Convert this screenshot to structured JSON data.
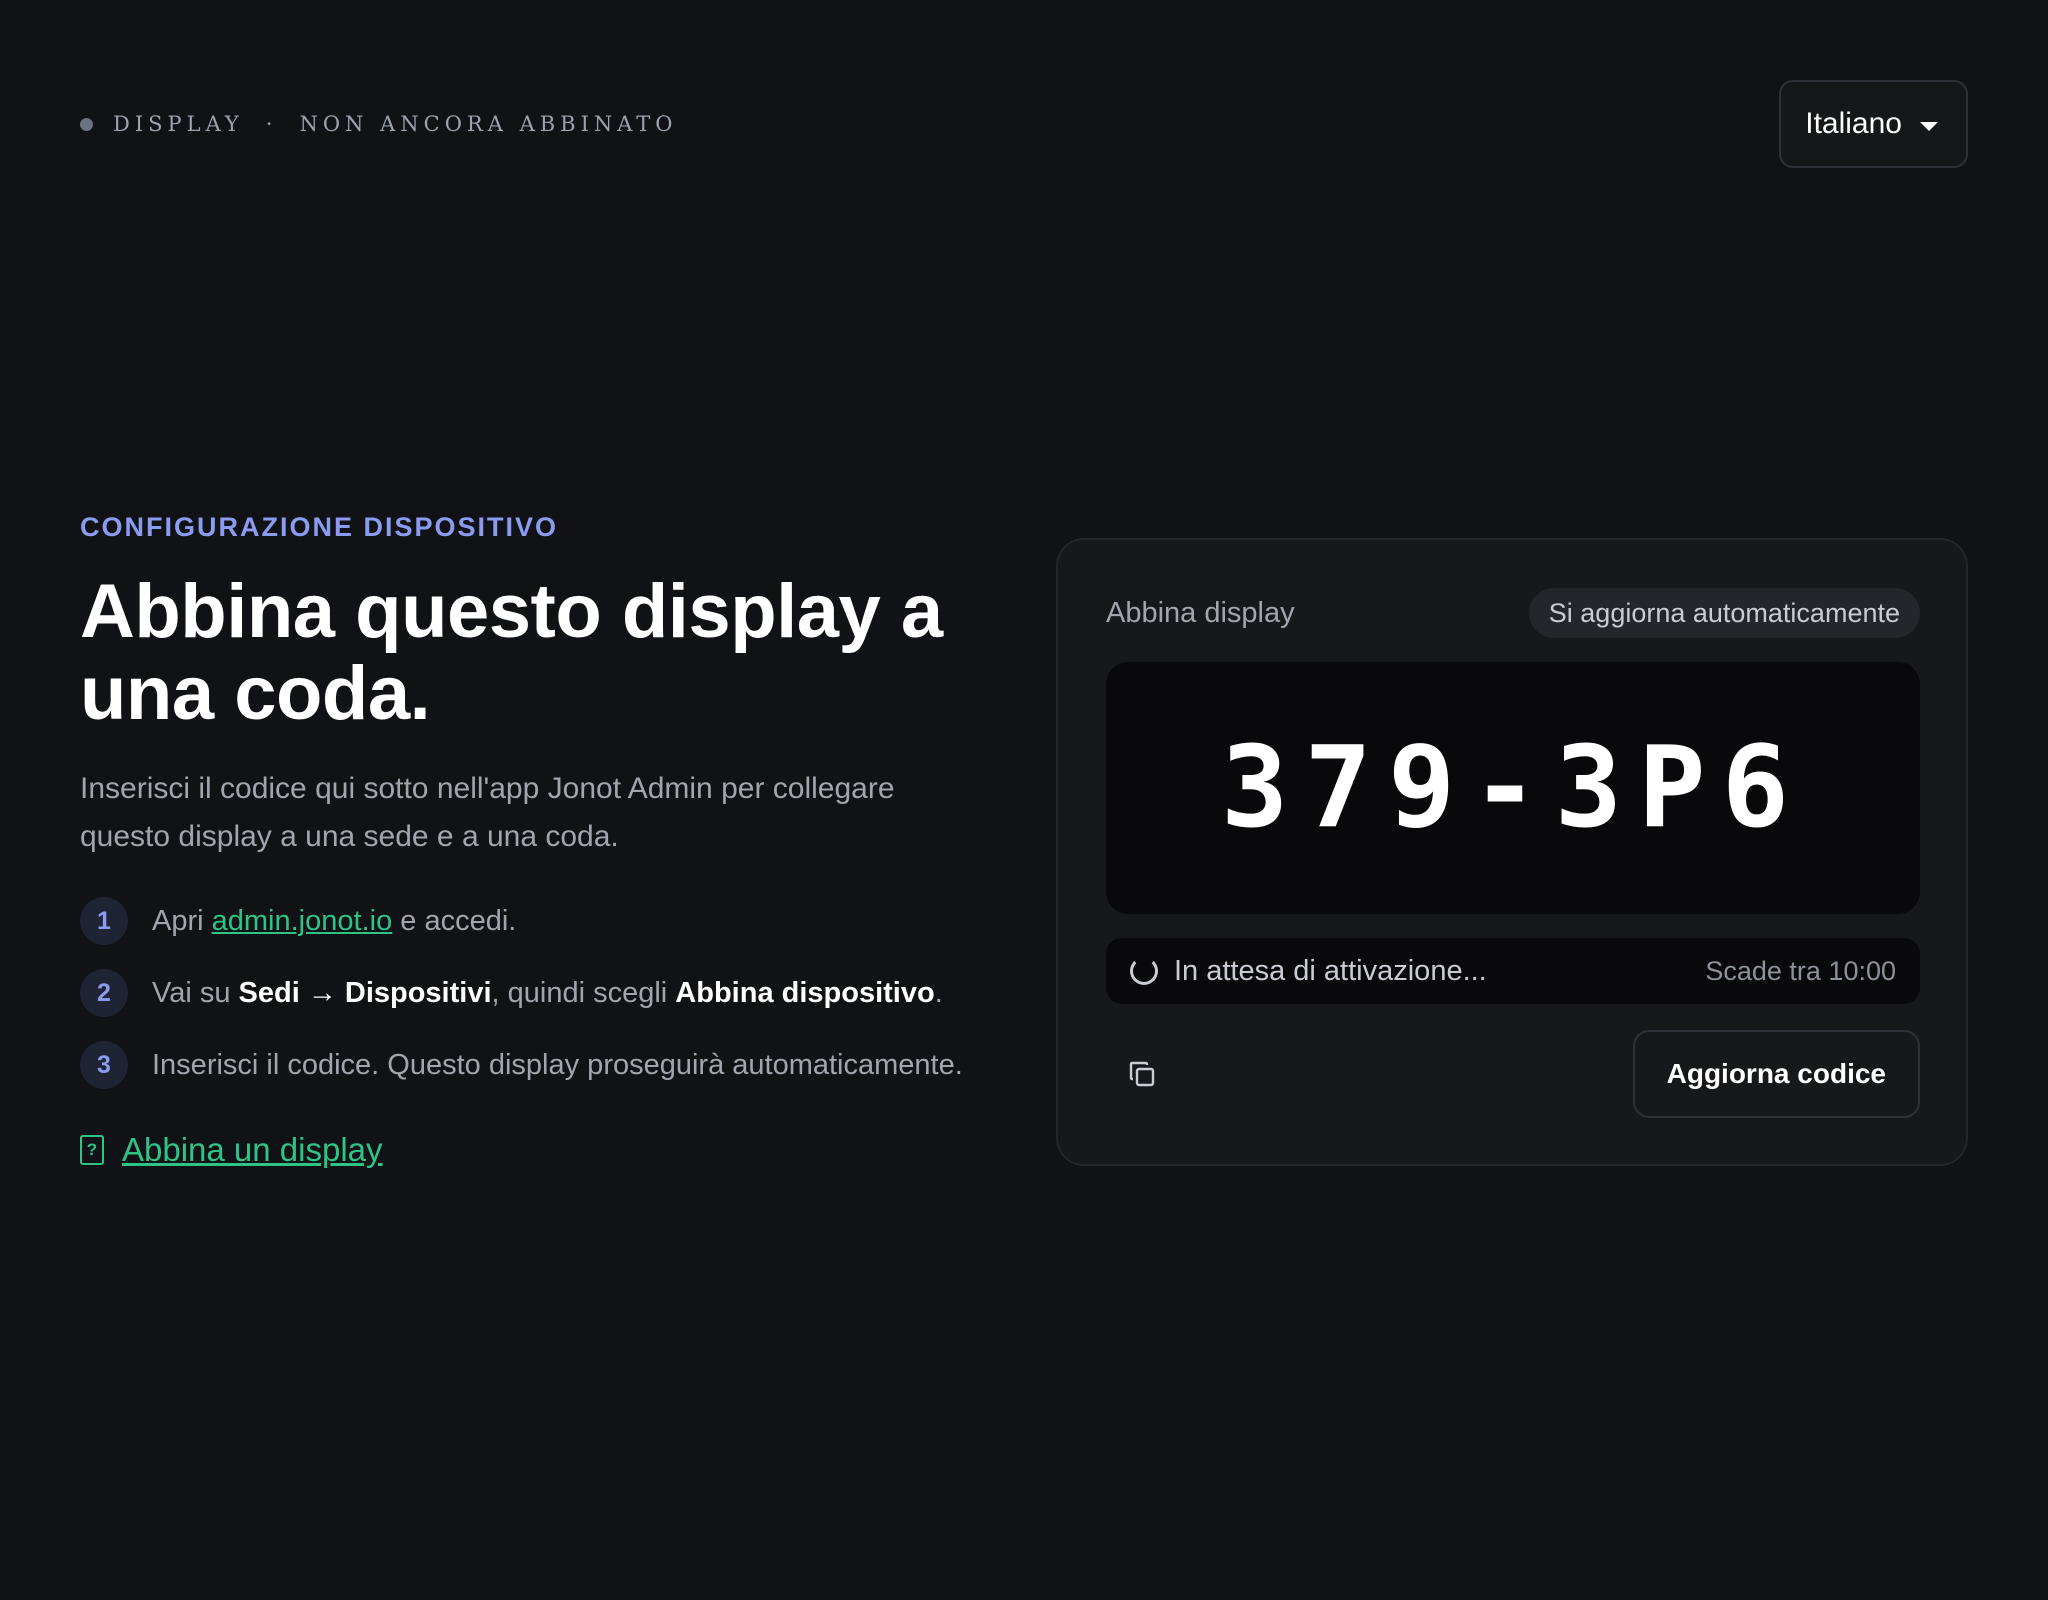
{
  "header": {
    "status_device": "DISPLAY",
    "status_separator": "·",
    "status_state": "NON ANCORA ABBINATO",
    "language": {
      "selected": "Italiano",
      "icon": "chevron-down-icon"
    }
  },
  "intro": {
    "eyebrow": "CONFIGURAZIONE DISPOSITIVO",
    "title": "Abbina questo display a una coda.",
    "description": "Inserisci il codice qui sotto nell'app Jonot Admin per collegare questo display a una sede e a una coda."
  },
  "steps": [
    {
      "number": "1",
      "pre": "Apri ",
      "link": "admin.jonot.io",
      "post": " e accedi."
    },
    {
      "number": "2",
      "pre": "Vai su ",
      "bold1": "Sedi → Dispositivi",
      "mid": ", quindi scegli ",
      "bold2": "Abbina dispositivo",
      "post": "."
    },
    {
      "number": "3",
      "text": "Inserisci il codice. Questo display proseguirà automaticamente."
    }
  ],
  "guide_link": {
    "label": "Abbina un display",
    "icon": "help-doc-icon"
  },
  "pairing_card": {
    "title": "Abbina display",
    "badge": "Si aggiorna automaticamente",
    "code": "379-3P6",
    "waiting_text": "In attesa di attivazione...",
    "expires_text": "Scade tra 10:00",
    "copy_icon": "copy-icon",
    "refresh_label": "Aggiorna codice"
  },
  "colors": {
    "background": "#111215",
    "accent_blue": "#8b9cf0",
    "link_green": "#2ec487",
    "card": "#17181c"
  }
}
